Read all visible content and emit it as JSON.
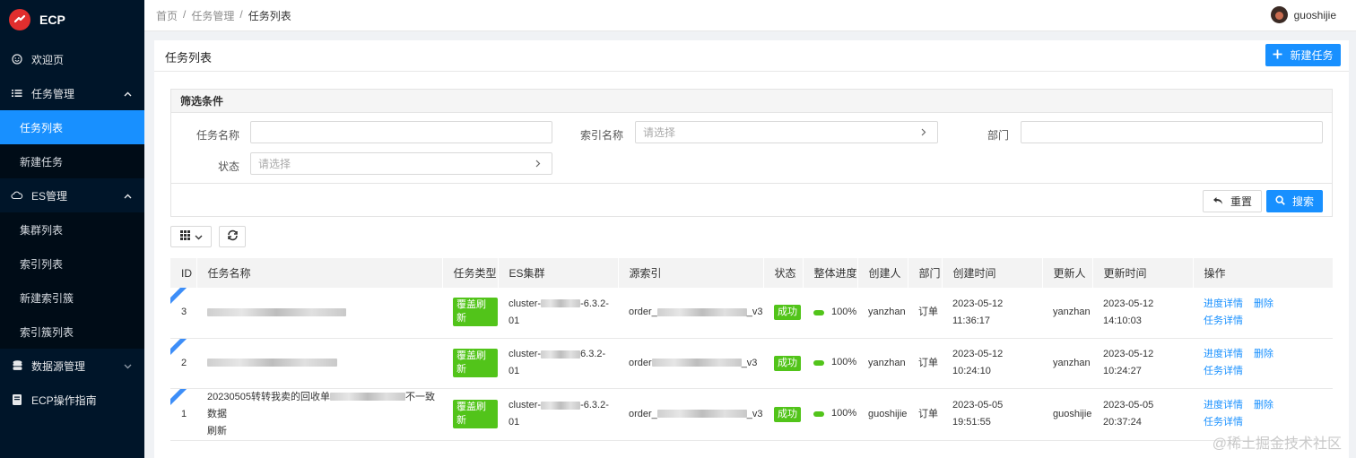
{
  "app": {
    "name": "ECP"
  },
  "sidebar": {
    "items": [
      {
        "label": "欢迎页",
        "icon": "smile-icon"
      },
      {
        "label": "任务管理",
        "icon": "list-icon",
        "expanded": true,
        "children": [
          {
            "label": "任务列表",
            "active": true
          },
          {
            "label": "新建任务"
          }
        ]
      },
      {
        "label": "ES管理",
        "icon": "cloud-icon",
        "expanded": true,
        "children": [
          {
            "label": "集群列表"
          },
          {
            "label": "索引列表"
          },
          {
            "label": "新建索引簇"
          },
          {
            "label": "索引簇列表"
          }
        ]
      },
      {
        "label": "数据源管理",
        "icon": "database-icon",
        "expanded": false
      },
      {
        "label": "ECP操作指南",
        "icon": "book-icon"
      }
    ]
  },
  "breadcrumb": [
    "首页",
    "/",
    "任务管理",
    "/",
    "任务列表"
  ],
  "user": {
    "name": "guoshijie"
  },
  "page": {
    "title": "任务列表",
    "new_button": "新建任务"
  },
  "filter": {
    "title": "筛选条件",
    "task_name_label": "任务名称",
    "index_name_label": "索引名称",
    "index_name_placeholder": "请选择",
    "dept_label": "部门",
    "status_label": "状态",
    "status_placeholder": "请选择",
    "reset_button": "重置",
    "search_button": "搜索"
  },
  "table": {
    "columns": [
      "ID",
      "任务名称",
      "任务类型",
      "ES集群",
      "源索引",
      "状态",
      "整体进度",
      "创建人",
      "部门",
      "创建时间",
      "更新人",
      "更新时间",
      "操作"
    ],
    "rows": [
      {
        "id": "3",
        "name": "",
        "type": "覆盖刷新",
        "cluster_a": "cluster-",
        "cluster_b": "-6.3.2-",
        "cluster_c": "01",
        "source_a": "order_",
        "source_b": "_v3",
        "status": "成功",
        "progress": "100%",
        "creator": "yanzhan",
        "dept": "订单",
        "created_date": "2023-05-12",
        "created_time": "11:36:17",
        "updater": "yanzhan",
        "updated_date": "2023-05-12",
        "updated_time": "14:10:03",
        "op_detail": "进度详情",
        "op_delete": "删除",
        "op_task": "任务详情"
      },
      {
        "id": "2",
        "name": "",
        "type": "覆盖刷新",
        "cluster_a": "cluster-",
        "cluster_b": "6.3.2-",
        "cluster_c": "01",
        "source_a": "order",
        "source_b": "_v3",
        "status": "成功",
        "progress": "100%",
        "creator": "yanzhan",
        "dept": "订单",
        "created_date": "2023-05-12",
        "created_time": "10:24:10",
        "updater": "yanzhan",
        "updated_date": "2023-05-12",
        "updated_time": "10:24:27",
        "op_detail": "进度详情",
        "op_delete": "删除",
        "op_task": "任务详情"
      },
      {
        "id": "1",
        "name_a": "20230505转转我卖的回收单",
        "name_b": "不一致数据",
        "name_c": "刷新",
        "type": "覆盖刷新",
        "cluster_a": "cluster-",
        "cluster_b": "-6.3.2-",
        "cluster_c": "01",
        "source_a": "order_",
        "source_b": "_v3",
        "status": "成功",
        "progress": "100%",
        "creator": "guoshijie",
        "dept": "订单",
        "created_date": "2023-05-05",
        "created_time": "19:51:55",
        "updater": "guoshijie",
        "updated_date": "2023-05-05",
        "updated_time": "20:37:24",
        "op_detail": "进度详情",
        "op_delete": "删除",
        "op_task": "任务详情"
      }
    ]
  },
  "watermark": "@稀土掘金技术社区",
  "colors": {
    "sidebar_bg": "#001529",
    "primary": "#1890ff",
    "success": "#52c41a",
    "logo_red": "#e02e2e"
  }
}
